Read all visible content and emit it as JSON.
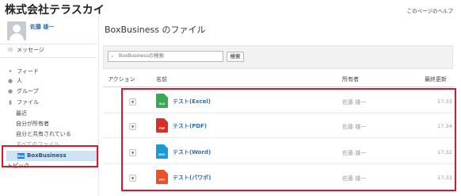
{
  "header": {
    "company": "株式会社テラスカイ",
    "help_link": "このページのヘルプ"
  },
  "user": {
    "name": "佐藤 雄一"
  },
  "sidebar": {
    "messages": "メッセージ",
    "nav": [
      "フィード",
      "人",
      "グループ",
      "ファイル"
    ],
    "file_sub": [
      "最近",
      "自分が所有者",
      "自分と共有されている",
      "すべてのファイル"
    ],
    "selected": {
      "logo": "box",
      "label": "BoxBusiness"
    },
    "topics": "トピック"
  },
  "main": {
    "title": "BoxBusiness のファイル",
    "search": {
      "placeholder": "BoxBusinessの検索",
      "button": "検索"
    },
    "columns": {
      "action": "アクション",
      "name": "名前",
      "owner": "所有者",
      "modified": "最終更新"
    },
    "rows": [
      {
        "type": "XLS",
        "name": "テスト(Excel)",
        "owner": "佐藤 雄一",
        "time": "17:33",
        "color": "#3aa757"
      },
      {
        "type": "PDF",
        "name": "テスト(PDF)",
        "owner": "佐藤 雄一",
        "time": "17:34",
        "color": "#d93025"
      },
      {
        "type": "DOC",
        "name": "テスト(Word)",
        "owner": "佐藤 雄一",
        "time": "17:32",
        "color": "#1a9bd7"
      },
      {
        "type": "PPT",
        "name": "テスト(パワポ)",
        "owner": "佐藤 雄一",
        "time": "17:33",
        "color": "#e8532a"
      }
    ]
  },
  "colors": {
    "highlight_border": "#d9192a",
    "link": "#2d6fb5",
    "selected_bg": "#cfe3f5"
  }
}
